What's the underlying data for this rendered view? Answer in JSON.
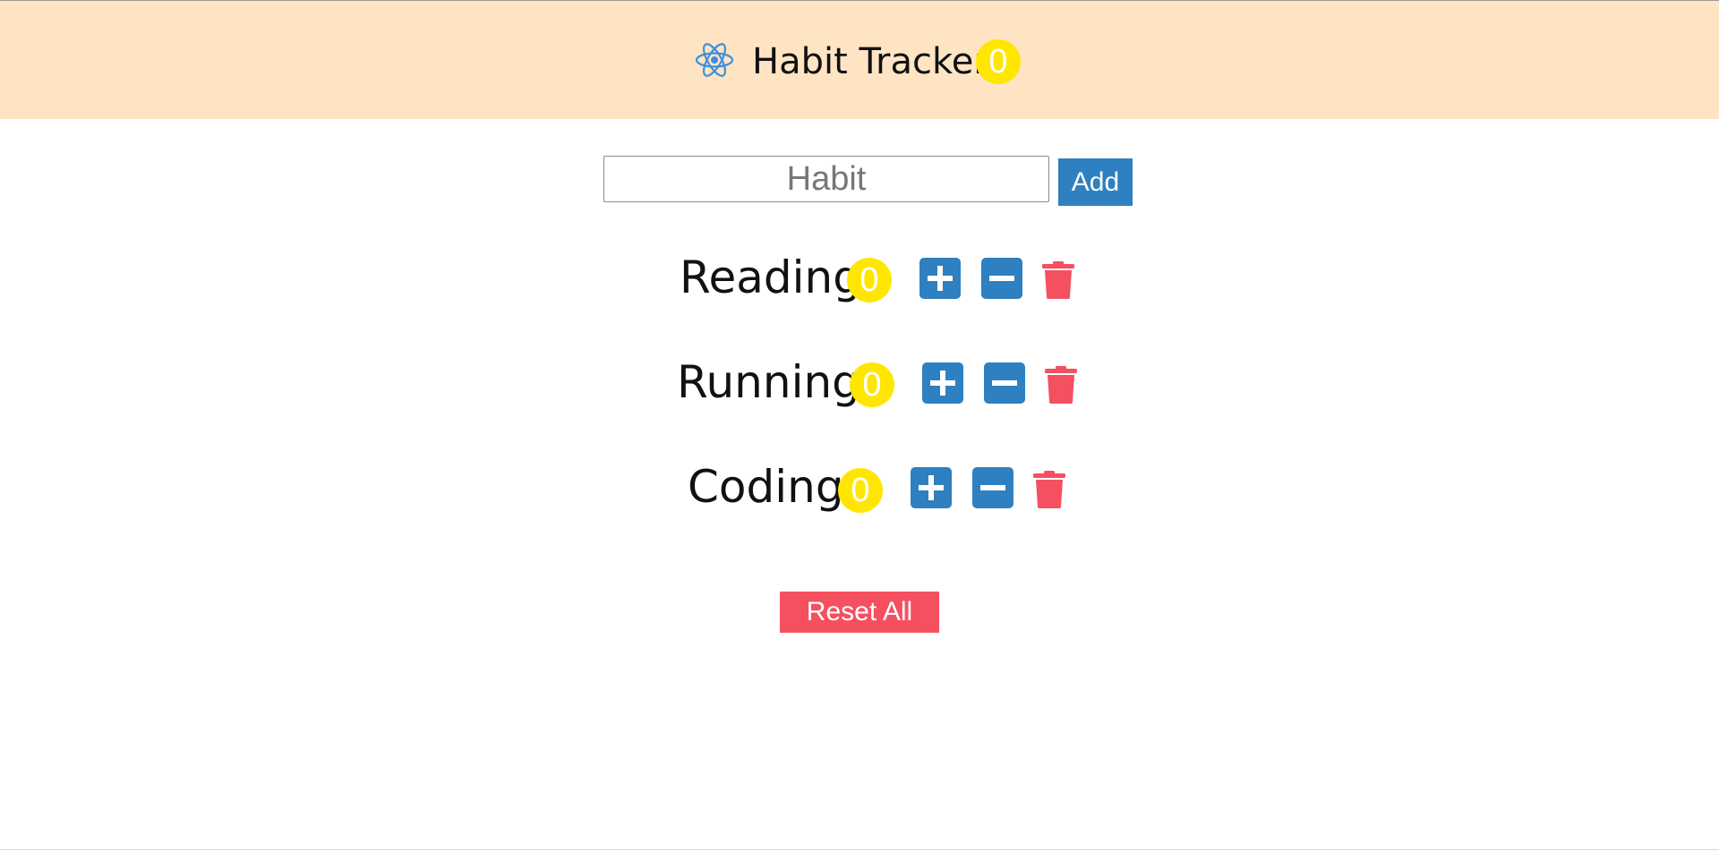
{
  "navbar": {
    "logo_icon": "react-atom-icon",
    "title": "Habit Tracker",
    "total_count": "0",
    "background_color": "#ffe4c4",
    "badge_color": "#ffe600"
  },
  "add_form": {
    "input_value": "",
    "input_placeholder": "Habit",
    "add_label": "Add",
    "button_color": "#2e80c0"
  },
  "habits": [
    {
      "name": "Reading",
      "count": "0",
      "increase_icon": "plus-square-icon",
      "decrease_icon": "minus-square-icon",
      "delete_icon": "trash-icon"
    },
    {
      "name": "Running",
      "count": "0",
      "increase_icon": "plus-square-icon",
      "decrease_icon": "minus-square-icon",
      "delete_icon": "trash-icon"
    },
    {
      "name": "Coding",
      "count": "0",
      "increase_icon": "plus-square-icon",
      "decrease_icon": "minus-square-icon",
      "delete_icon": "trash-icon"
    }
  ],
  "reset": {
    "label": "Reset All",
    "color": "#f45060"
  },
  "colors": {
    "action_blue": "#2e80c0",
    "delete_red": "#f45060"
  }
}
